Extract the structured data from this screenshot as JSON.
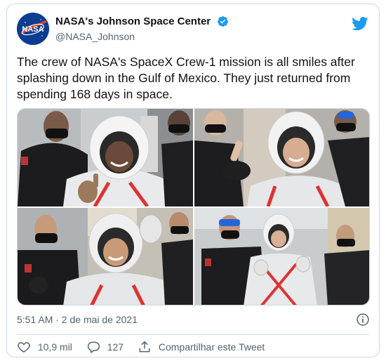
{
  "tweet": {
    "display_name": "NASA's Johnson Space Center",
    "handle": "@NASA_Johnson",
    "avatar_text": "NASA",
    "text": "The crew of NASA's SpaceX Crew-1 mission is all smiles after splashing down in the Gulf of Mexico. They just returned from spending 168 days in space.",
    "timestamp": "5:51 AM · 2 de mai de 2021"
  },
  "actions": {
    "likes": "10,9 mil",
    "replies": "127",
    "share_label": "Compartilhar este Tweet"
  },
  "media": {
    "photo_count": 4
  },
  "colors": {
    "brand_blue": "#1d9bf0",
    "text_primary": "#0f1419",
    "text_secondary": "#536471",
    "border": "#cfd9de"
  },
  "icons": {
    "verified": "verified-badge-icon",
    "bird": "twitter-bird-icon",
    "info": "info-icon",
    "like": "heart-icon",
    "reply": "reply-icon",
    "share": "share-icon"
  }
}
